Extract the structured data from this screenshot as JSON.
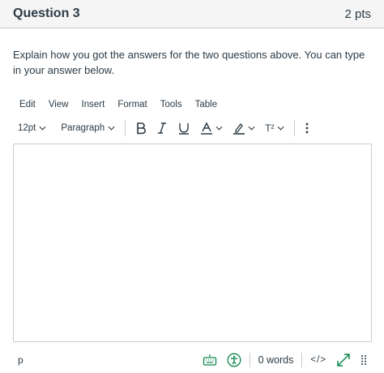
{
  "question": {
    "title": "Question 3",
    "points": "2 pts",
    "prompt": "Explain how you got the answers for the two questions above. You can type in your answer below."
  },
  "menubar": {
    "items": [
      "Edit",
      "View",
      "Insert",
      "Format",
      "Tools",
      "Table"
    ]
  },
  "toolbar": {
    "font_size": "12pt",
    "block_format": "Paragraph",
    "superscript_label": "T²",
    "icons": [
      "bold-icon",
      "italic-icon",
      "underline-icon",
      "text-color-icon",
      "highlight-icon",
      "superscript-icon",
      "more-icon"
    ],
    "accent_color": "#2d3b45"
  },
  "editor": {
    "content": ""
  },
  "statusbar": {
    "path": "p",
    "word_count": "0 words",
    "code_view": "</>",
    "icons": [
      "keyboard-icon",
      "accessibility-icon",
      "fullscreen-icon",
      "resize-grip-icon"
    ],
    "icon_color": "#0b874b"
  }
}
